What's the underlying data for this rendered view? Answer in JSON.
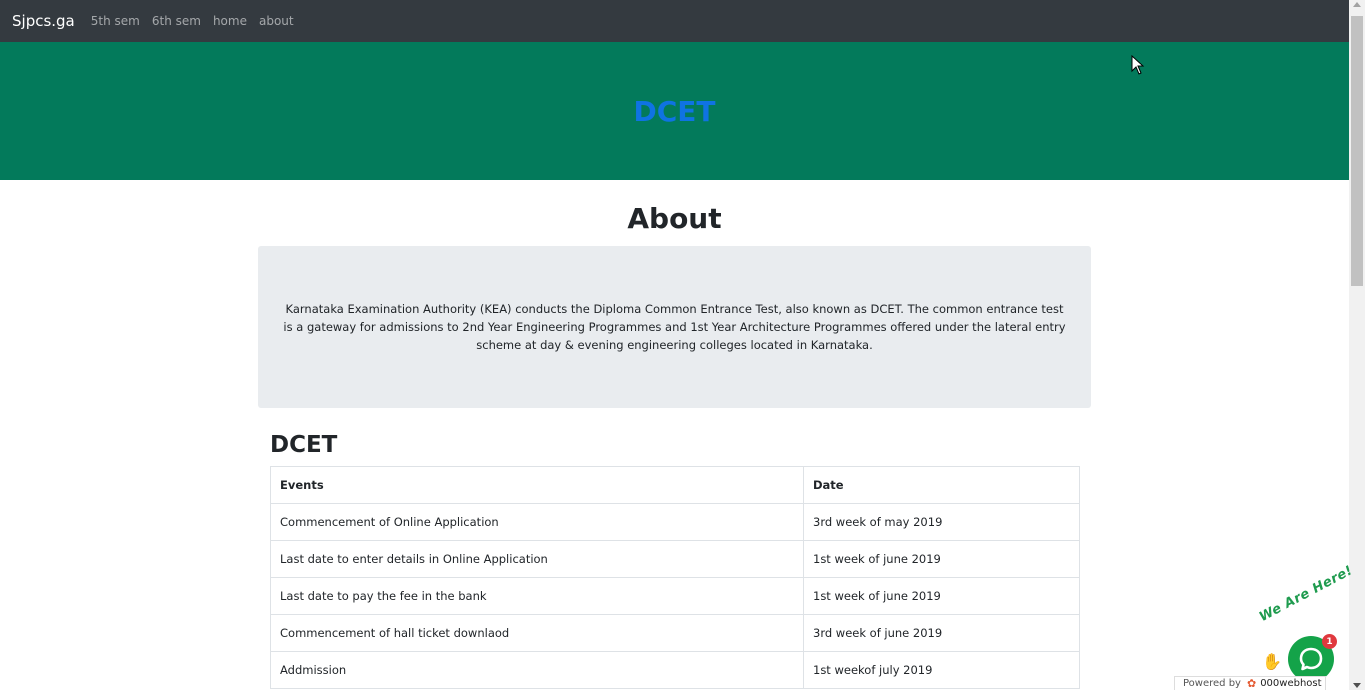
{
  "navbar": {
    "brand": "Sjpcs.ga",
    "links": [
      "5th sem",
      "6th sem",
      "home",
      "about"
    ]
  },
  "hero": {
    "title": "DCET"
  },
  "about": {
    "title": "About",
    "text": "Karnataka Examination Authority (KEA) conducts the Diploma Common Entrance Test, also known as DCET. The common entrance test is a gateway for admissions to 2nd Year Engineering Programmes and 1st Year Architecture Programmes offered under the lateral entry scheme at day & evening engineering colleges located in Karnataka."
  },
  "section": {
    "title": "DCET",
    "headers": [
      "Events",
      "Date"
    ],
    "rows": [
      [
        "Commencement of Online Application",
        "3rd week of may 2019"
      ],
      [
        "Last date to enter details in Online Application",
        "1st week of june 2019"
      ],
      [
        "Last date to pay the fee in the bank",
        "1st week of june 2019"
      ],
      [
        "Commencement of hall ticket downlaod",
        "3rd week of june 2019"
      ],
      [
        "Addmission",
        "1st weekof july 2019"
      ]
    ]
  },
  "chat": {
    "tagline": "We Are Here!",
    "badge_count": "1"
  },
  "powered": {
    "label": "Powered by",
    "host": "000webhost"
  },
  "colors": {
    "navbar": "#343a40",
    "hero_bg": "#037a5b",
    "hero_title": "#0f73e3",
    "about_box": "#e9ecef"
  }
}
